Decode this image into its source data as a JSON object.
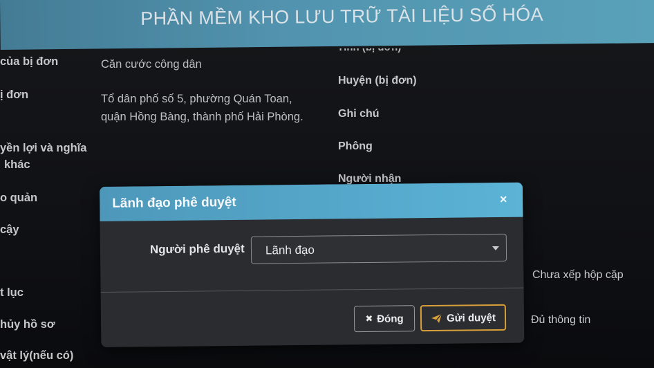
{
  "header": {
    "title": "PHẦN MỀM KHO LƯU TRỮ TÀI LIỆU SỐ HÓA"
  },
  "background": {
    "left_labels": [
      "của bị đơn",
      "ị đơn",
      "yền lợi và nghĩa",
      "khác",
      "o quản",
      "cậy",
      "t lục",
      "hủy hồ sơ",
      "vật lý(nếu có)"
    ],
    "values": {
      "id_type": "Căn cước công dân",
      "address_line1": "Tổ dân phố số 5, phường Quán Toan,",
      "address_line2": "quận Hồng Bàng, thành phố Hải Phòng."
    },
    "right_labels": {
      "cut_top": "Tỉnh (bị đơn)",
      "district": "Huyện (bị đơn)",
      "note": "Ghi chú",
      "room": "Phông",
      "receiver": "Người nhận"
    },
    "far_right": {
      "box_status": "Chưa xếp hộp cặp",
      "info_status": "Đủ thông tin"
    }
  },
  "modal": {
    "title": "Lãnh đạo phê duyệt",
    "close_symbol": "×",
    "approver_label": "Người phê duyệt",
    "approver_value": "Lãnh đạo",
    "close_button": "Đóng",
    "close_button_icon": "✖",
    "send_button": "Gửi duyệt"
  },
  "colors": {
    "header": "#5aa1bf",
    "modal_header": "#5bb3d6",
    "send_border": "#d9a03a"
  }
}
